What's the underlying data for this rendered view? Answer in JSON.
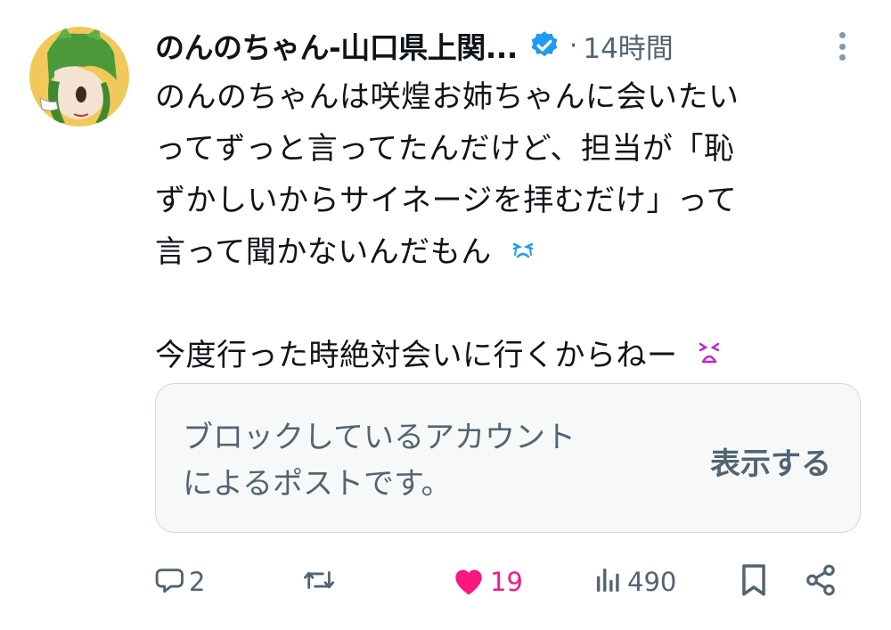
{
  "author": {
    "display_name": "のんのちゃん-山口県上関...",
    "verified": true,
    "separator": "·",
    "time_ago": "14時間"
  },
  "post": {
    "lines": [
      "のんのちゃんは咲煌お姉ちゃんに会いたい",
      "ってずっと言ってたんだけど、担当が「恥",
      "ずかしいからサイネージを拝むだけ」って",
      "言って聞かないんだもん"
    ],
    "line_last": "今度行った時絶対会いに行くからねー",
    "emojis": [
      "crying-face-emoji",
      "tired-face-emoji"
    ]
  },
  "blocked_card": {
    "message_line1": "ブロックしているアカウント",
    "message_line2": "によるポストです。",
    "show_label": "表示する"
  },
  "actions": {
    "reply_count": "2",
    "repost_count": "",
    "like_count": "19",
    "views_count": "490"
  },
  "colors": {
    "text": "#0f1419",
    "muted": "#536471",
    "like": "#f91880",
    "verified": "#1d9bf0",
    "card_bg": "#f7f9f9",
    "card_border": "#cfd9de"
  }
}
